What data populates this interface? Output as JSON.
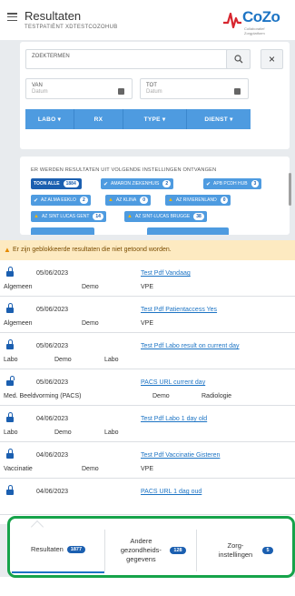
{
  "header": {
    "title": "Resultaten",
    "subtitle": "TESTPATIËNT XDTESTCOZOHUB",
    "logo_text": "CoZo",
    "logo_subtext": "Collaboratief Zorgplatform"
  },
  "search": {
    "keywords_label": "ZOEKTERMEN",
    "from_label": "VAN",
    "from_placeholder": "Datum",
    "to_label": "TOT",
    "to_placeholder": "Datum",
    "clear_symbol": "×",
    "filters": [
      "LABO ▾",
      "RX",
      "TYPE ▾",
      "DIENST ▾"
    ]
  },
  "institutions": {
    "title": "ER WERDEN RESULTATEN UIT VOLGENDE INSTELLINGEN ONTVANGEN",
    "show_all_label": "TOON ALLE",
    "show_all_count": "1884",
    "chips": [
      {
        "name": "AMARON ZIEKENHUIS",
        "count": "2",
        "status": "check"
      },
      {
        "name": "APB PCDH HUB",
        "count": "3",
        "status": "check"
      },
      {
        "name": "AZ ALMA EEKLO",
        "count": "2",
        "status": "check"
      },
      {
        "name": "AZ KLINA",
        "count": "0",
        "status": "warning"
      },
      {
        "name": "AZ RIVIERENLAND",
        "count": "0",
        "status": "warning"
      },
      {
        "name": "AZ SINT LUCAS GENT",
        "count": "14",
        "status": "warning"
      },
      {
        "name": "AZ SINT-LUCAS BRUGGE",
        "count": "38",
        "status": "warning"
      }
    ]
  },
  "warning": {
    "text": "Er zijn geblokkeerde resultaten die niet getoond worden."
  },
  "results": [
    {
      "date": "05/06/2023",
      "title": "Test Pdf Vandaag",
      "col1": "Algemeen",
      "col2": "Demo",
      "col3": "VPE",
      "locked": true
    },
    {
      "date": "05/06/2023",
      "title": "Test Pdf Patientaccess Yes",
      "col1": "Algemeen",
      "col2": "Demo",
      "col3": "VPE",
      "locked": true
    },
    {
      "date": "05/06/2023",
      "title": "Test Pdf Labo result on current day",
      "col1": "Labo",
      "col2": "Demo",
      "col3": "Labo",
      "locked": true
    },
    {
      "date": "05/06/2023",
      "title": "PACS URL current day",
      "col1": "Med. Beeldvorming (PACS)",
      "col2": "Demo",
      "col3": "Radiologie",
      "locked": false
    },
    {
      "date": "04/06/2023",
      "title": "Test Pdf Labo 1 day old",
      "col1": "Labo",
      "col2": "Demo",
      "col3": "Labo",
      "locked": true
    },
    {
      "date": "04/06/2023",
      "title": "Test Pdf Vaccinatie Gisteren",
      "col1": "Vaccinatie",
      "col2": "Demo",
      "col3": "VPE",
      "locked": true
    },
    {
      "date": "04/06/2023",
      "title": "PACS URL 1 dag oud",
      "col1": "",
      "col2": "",
      "col3": "",
      "locked": true
    }
  ],
  "bottom_tabs": [
    {
      "label": "Resultaten",
      "count": "1877"
    },
    {
      "label": "Andere gezondheids-gegevens",
      "count": "128"
    },
    {
      "label": "Zorg-instellingen",
      "count": "5"
    }
  ],
  "colors": {
    "accent": "#1d74c4",
    "filter_button": "#4e9be0",
    "badge": "#1b5fb0",
    "warning_bg": "#fdeac1",
    "highlight_border": "#16a34a"
  }
}
